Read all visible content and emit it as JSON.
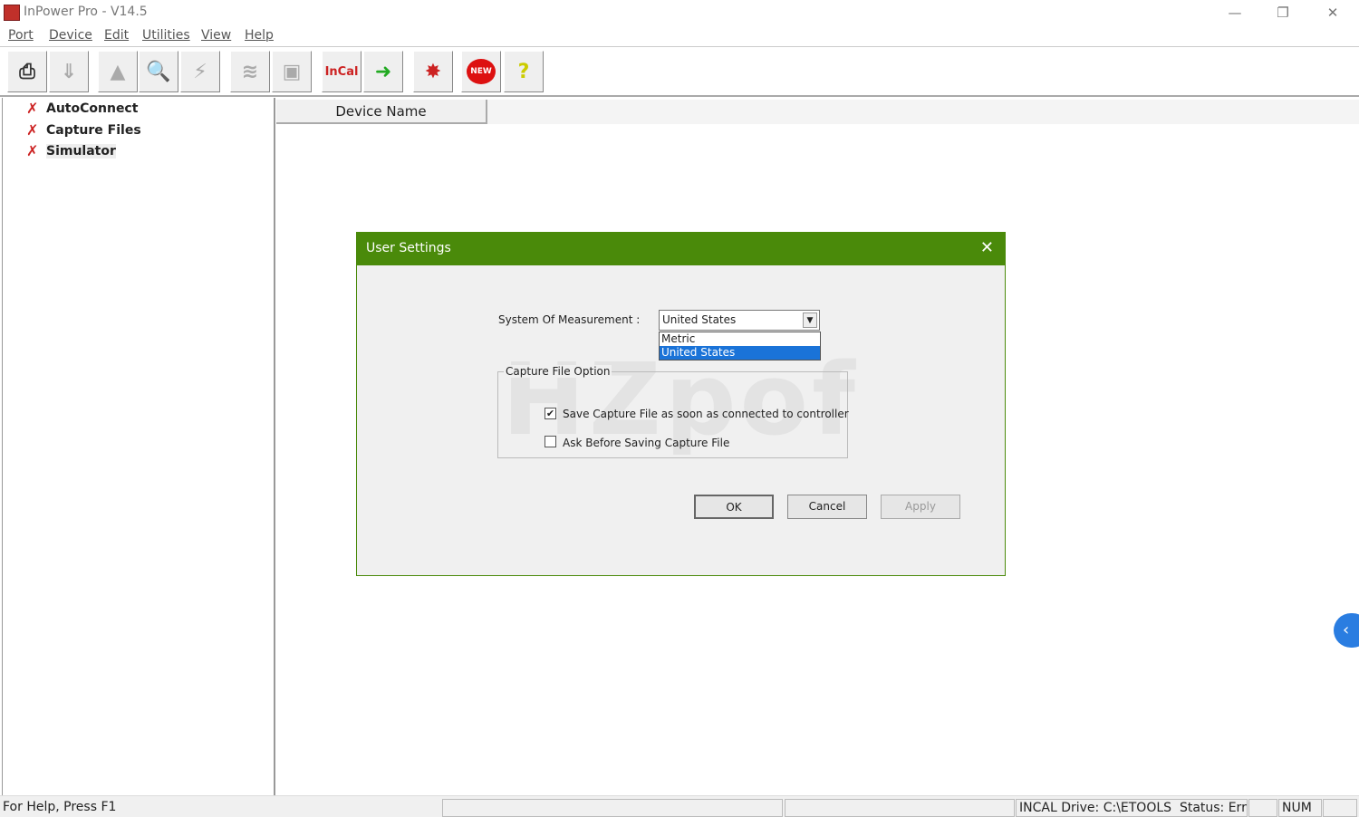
{
  "window": {
    "title": "InPower Pro - V14.5",
    "minimize": "—",
    "maximize": "❐",
    "close": "✕"
  },
  "menu": [
    "Port",
    "Device",
    "Edit",
    "Utilities",
    "View",
    "Help"
  ],
  "toolbar": [
    {
      "icon": "connect-icon",
      "glyph": "⎙",
      "enabled": true
    },
    {
      "icon": "download-icon",
      "glyph": "⇓",
      "enabled": false
    },
    {
      "icon": "triangle-icon",
      "glyph": "▲",
      "enabled": false
    },
    {
      "icon": "magnifier-icon",
      "glyph": "🔍",
      "enabled": false
    },
    {
      "icon": "lightning-icon",
      "glyph": "⚡",
      "enabled": false
    },
    {
      "icon": "waveform-icon",
      "glyph": "≋",
      "enabled": false
    },
    {
      "icon": "device-icon",
      "glyph": "▣",
      "enabled": false
    },
    {
      "icon": "incal-icon",
      "glyph": "InCal",
      "enabled": true
    },
    {
      "icon": "exit-door-icon",
      "glyph": "➜",
      "enabled": true
    },
    {
      "icon": "explode-icon",
      "glyph": "✸",
      "enabled": true
    },
    {
      "icon": "new-icon",
      "glyph": "NEW",
      "enabled": true
    },
    {
      "icon": "help-icon",
      "glyph": "?",
      "enabled": true
    }
  ],
  "tree": [
    "AutoConnect",
    "Capture Files",
    "Simulator"
  ],
  "list": {
    "column": "Device Name"
  },
  "dialog": {
    "title": "User Settings",
    "close": "✕",
    "measurement_label": "System Of Measurement :",
    "measurement_value": "United States",
    "options": [
      "Metric",
      "United States"
    ],
    "group_label": "Capture File Option",
    "save_capture": {
      "label": "Save Capture File as soon as connected to controller",
      "checked": true
    },
    "ask_before": {
      "label": "Ask Before Saving Capture File",
      "checked": false
    },
    "ok": "OK",
    "cancel": "Cancel",
    "apply": "Apply",
    "watermark": "HZpof"
  },
  "status": {
    "help": "For Help, Press F1",
    "incal": "INCAL Drive: C:\\ETOOLS",
    "state": "Status: Err",
    "num": "NUM"
  },
  "colors": {
    "dialog_header": "#4a8a0a",
    "selection": "#1a73d8"
  }
}
